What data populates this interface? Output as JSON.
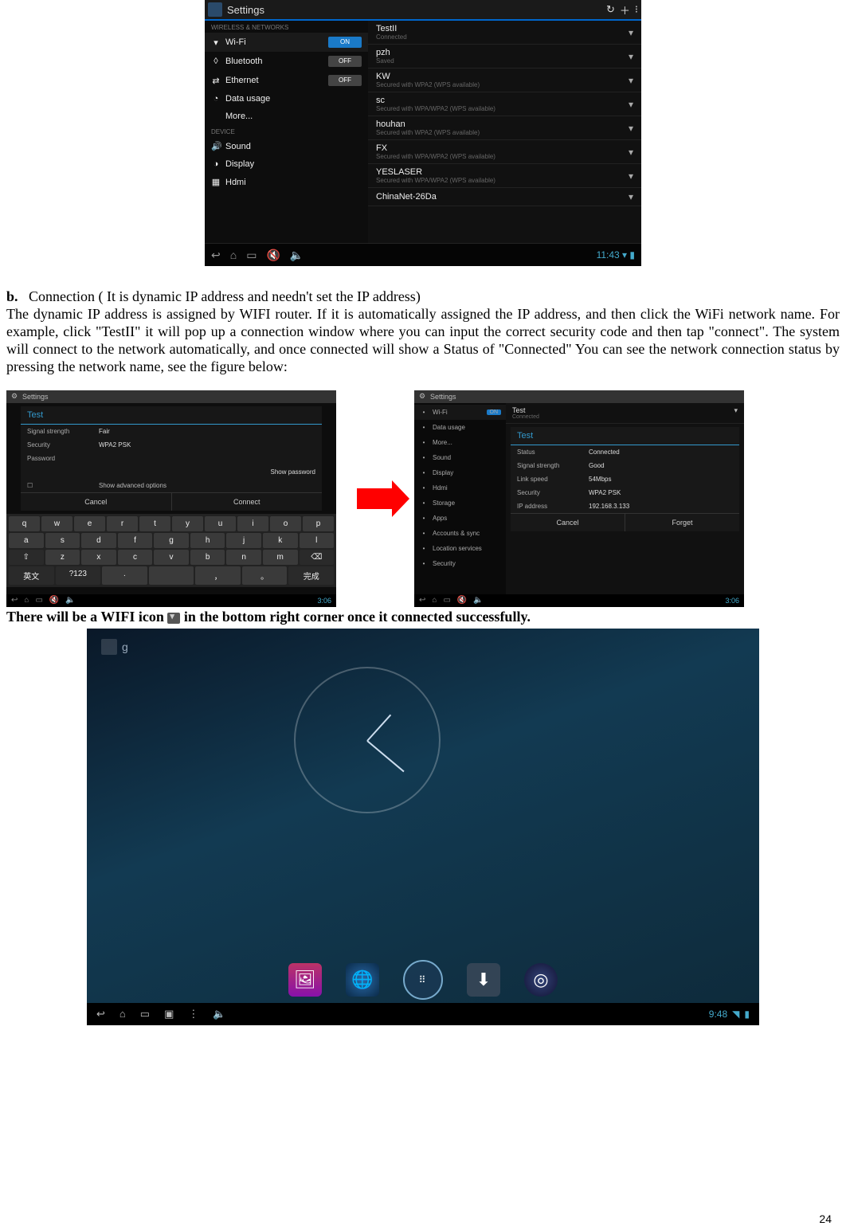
{
  "page_number": "24",
  "ss1": {
    "title": "Settings",
    "top_icons": [
      "↻",
      "＋",
      "⁝"
    ],
    "cat1": "WIRELESS & NETWORKS",
    "items1": [
      {
        "icon": "▾",
        "label": "Wi-Fi",
        "toggle": "ON",
        "on": true,
        "sel": true
      },
      {
        "icon": "◊",
        "label": "Bluetooth",
        "toggle": "OFF",
        "on": false
      },
      {
        "icon": "⇄",
        "label": "Ethernet",
        "toggle": "OFF",
        "on": false
      },
      {
        "icon": "◔",
        "label": "Data usage"
      },
      {
        "icon": "",
        "label": "More..."
      }
    ],
    "cat2": "DEVICE",
    "items2": [
      {
        "icon": "🔊",
        "label": "Sound"
      },
      {
        "icon": "◑",
        "label": "Display"
      },
      {
        "icon": "▦",
        "label": "Hdmi"
      }
    ],
    "nets": [
      {
        "name": "TestII",
        "sub": "Connected"
      },
      {
        "name": "pzh",
        "sub": "Saved"
      },
      {
        "name": "KW",
        "sub": "Secured with WPA2 (WPS available)"
      },
      {
        "name": "sc",
        "sub": "Secured with WPA/WPA2 (WPS available)"
      },
      {
        "name": "houhan",
        "sub": "Secured with WPA2 (WPS available)"
      },
      {
        "name": "FX",
        "sub": "Secured with WPA/WPA2 (WPS available)"
      },
      {
        "name": "YESLASER",
        "sub": "Secured with WPA/WPA2 (WPS available)"
      },
      {
        "name": "ChinaNet-26Da",
        "sub": ""
      }
    ],
    "nav_icons": [
      "↩",
      "⌂",
      "▭",
      "🔇",
      "🔈"
    ],
    "clock": "11:43"
  },
  "para": {
    "bullet": "b.",
    "heading": "Connection ( It is dynamic IP address and needn't set the IP address)",
    "body": "The dynamic IP address is assigned by WIFI router. If it is automatically assigned the IP address, and then click the WiFi network name. For example, click \"TestII\" it will pop up a connection window where you can input the correct security code and then tap \"connect\". The system will connect to the network automatically, and once connected will show a Status of \"Connected\" You can see the network connection status by pressing the network name, see the figure below:"
  },
  "ss2": {
    "hdr": "Settings",
    "dlg_title": "Test",
    "rows": [
      {
        "l": "Signal strength",
        "v": "Fair"
      },
      {
        "l": "Security",
        "v": "WPA2 PSK"
      },
      {
        "l": "Password",
        "v": ""
      }
    ],
    "show_pw": "Show password",
    "show_adv": "Show advanced options",
    "cancel": "Cancel",
    "connect": "Connect",
    "kbd": [
      [
        "q",
        "w",
        "e",
        "r",
        "t",
        "y",
        "u",
        "i",
        "o",
        "p"
      ],
      [
        "a",
        "s",
        "d",
        "f",
        "g",
        "h",
        "j",
        "k",
        "l"
      ],
      [
        "⇧",
        "z",
        "x",
        "c",
        "v",
        "b",
        "n",
        "m",
        "⌫"
      ],
      [
        "英文",
        "?123",
        ".",
        "　",
        "，",
        "。",
        "完成"
      ]
    ],
    "nav": [
      "↩",
      "⌂",
      "▭",
      "🔇",
      "🔈"
    ],
    "clock": "3:06"
  },
  "ss3": {
    "hdr": "Settings",
    "left": [
      {
        "label": "Wi-Fi",
        "sel": true,
        "tog": "ON"
      },
      {
        "label": "Data usage"
      },
      {
        "label": "More..."
      },
      {
        "label": "Sound"
      },
      {
        "label": "Display"
      },
      {
        "label": "Hdmi"
      },
      {
        "label": "Storage"
      },
      {
        "label": "Apps"
      },
      {
        "label": "Accounts & sync"
      },
      {
        "label": "Location services"
      },
      {
        "label": "Security"
      }
    ],
    "net_row": {
      "name": "Test",
      "sub": "Connected"
    },
    "dlg_title": "Test",
    "rows": [
      {
        "l": "Status",
        "v": "Connected"
      },
      {
        "l": "Signal strength",
        "v": "Good"
      },
      {
        "l": "Link speed",
        "v": "54Mbps"
      },
      {
        "l": "Security",
        "v": "WPA2 PSK"
      },
      {
        "l": "IP address",
        "v": "192.168.3.133"
      }
    ],
    "cancel": "Cancel",
    "forget": "Forget",
    "nav": [
      "↩",
      "⌂",
      "▭",
      "🔇",
      "🔈"
    ],
    "clock": "3:06"
  },
  "line3_a": "There will be a WIFI icon ",
  "line3_b": " in the bottom right corner once it connected successfully.",
  "ss4": {
    "search": "g",
    "dock_icons": [
      "gallery-icon",
      "browser-icon",
      "apps-icon",
      "downloads-icon",
      "media-icon"
    ],
    "nav": [
      "↩",
      "⌂",
      "▭",
      "▣",
      "⋮",
      "🔈"
    ],
    "clock": "9:48"
  }
}
